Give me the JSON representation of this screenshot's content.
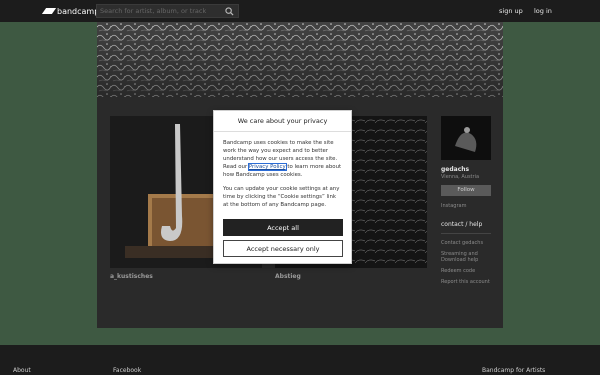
{
  "header": {
    "logo_text": "bandcamp",
    "search": {
      "placeholder": "Search for artist, album, or track",
      "value": ""
    },
    "signup_label": "sign up",
    "login_label": "log in"
  },
  "albums": [
    {
      "title": "a_kustisches"
    },
    {
      "title": "Abstieg"
    }
  ],
  "sidebar": {
    "band_name": "gedachs",
    "location": "Vienna, Austria",
    "follow_label": "Follow",
    "instagram_label": "Instagram",
    "contact_header": "contact / help",
    "links": [
      "Contact gedachs",
      "Streaming and Download help",
      "Redeem code",
      "Report this account"
    ]
  },
  "cookie_dialog": {
    "title": "We care about your privacy",
    "para1_before": "Bandcamp uses cookies to make the site work the way you expect and to better understand how our users access the site. Read our ",
    "privacy_link": "Privacy Policy",
    "para1_after": " to learn more about how Bandcamp uses cookies.",
    "para2": "You can update your cookie settings at any time by clicking the “Cookie settings” link at the bottom of any Bandcamp page.",
    "accept_all_label": "Accept all",
    "accept_necessary_label": "Accept necessary only"
  },
  "footer": {
    "about_label": "About",
    "facebook_label": "Facebook",
    "artists_label": "Bandcamp for Artists"
  },
  "colors": {
    "page_bg": "#3e5942",
    "topbar_bg": "#1c1c1c",
    "panel_bg": "#2a2a2a",
    "accept_bg": "#222222"
  }
}
